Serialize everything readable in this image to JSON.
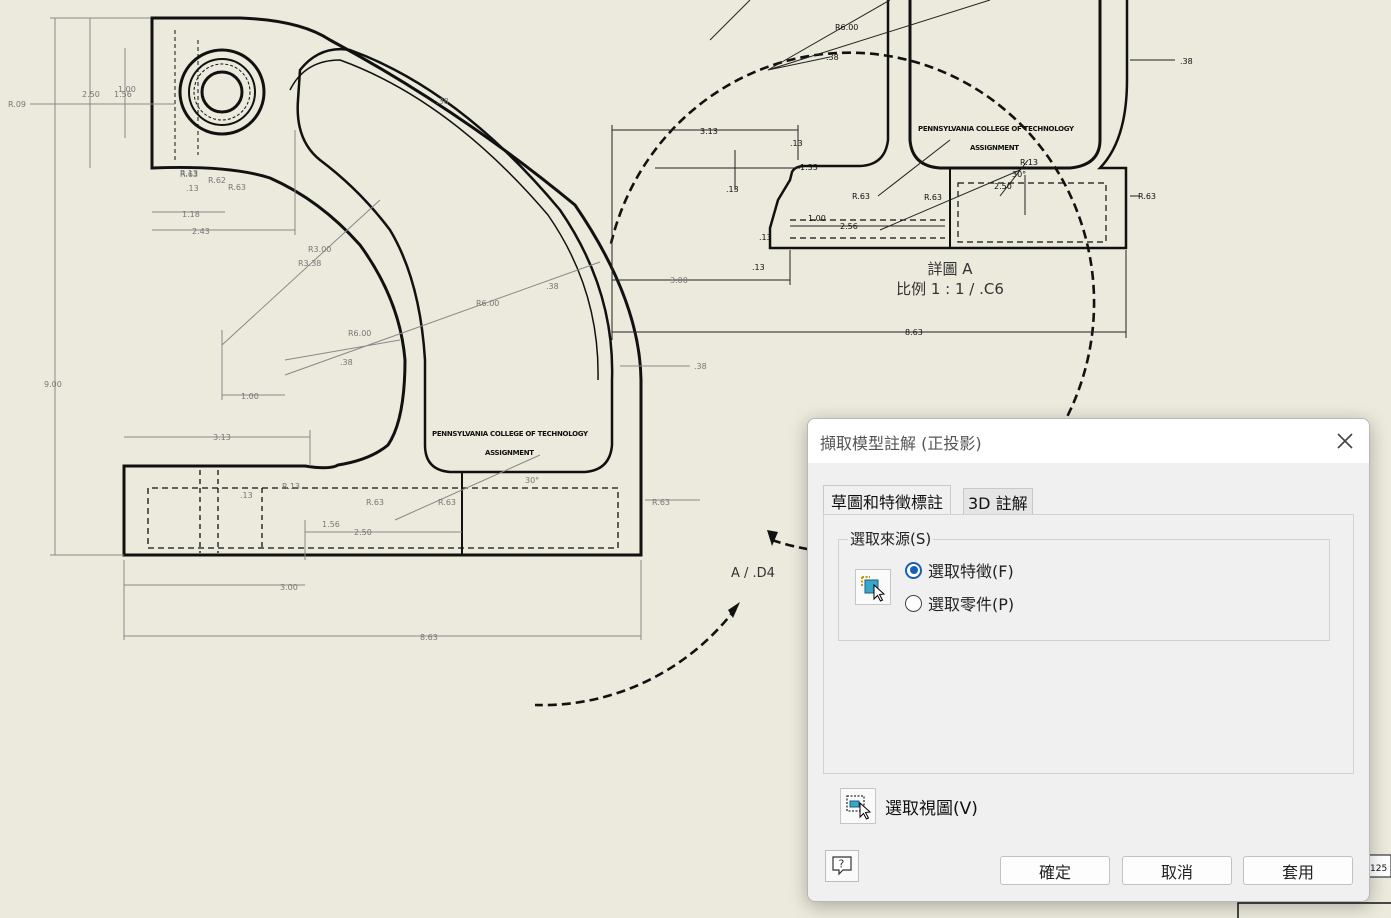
{
  "drawing": {
    "detail_view": {
      "title": "詳圖  A",
      "scale": "比例 1 : 1 / .C6"
    },
    "section_label": "A / .D4",
    "main_view_dims": [
      "R.09",
      "2.50",
      "1.00",
      "1.56",
      "R.63",
      "R.13",
      ".13",
      "R.62",
      "R.63",
      "1.18",
      "2.43",
      "R3.00",
      "R3.38",
      "R6.00",
      ".38",
      "1.00",
      "9.00",
      "3.13",
      ".13",
      "R.13",
      "2.50",
      "1.56",
      "R.63",
      "R.63",
      "R.63",
      "30°",
      "3.00",
      "8.63",
      "R6.00",
      ".38",
      ".38",
      "3.00",
      ".38"
    ],
    "detail_view_dims": [
      "R6.00",
      ".38",
      ".38",
      "3.13",
      ".13",
      ".13",
      "R.63",
      "R.63",
      "R.13",
      "30°",
      "2.50",
      "1.00",
      "2.56",
      ".13",
      "1.33",
      ".13",
      "R.63",
      "8.63"
    ],
    "engraving": {
      "line1": "PENNSYLVANIA COLLEGE OF TECHNOLOGY",
      "line2": "ASSIGNMENT"
    },
    "title_block_fragment": "125"
  },
  "dialog": {
    "title": "擷取模型註解 (正投影)",
    "icons": {
      "close": "close-icon",
      "select_feature": "select-feature-icon",
      "select_view": "select-view-icon",
      "help": "help-icon"
    },
    "tabs": [
      {
        "label": "草圖和特徵標註",
        "active": true
      },
      {
        "label": "3D 註解",
        "active": false
      }
    ],
    "source_group": {
      "legend": "選取來源(S)",
      "options": [
        {
          "label": "選取特徵(F)",
          "checked": true
        },
        {
          "label": "選取零件(P)",
          "checked": false
        }
      ]
    },
    "select_view_label": "選取視圖(V)",
    "buttons": {
      "ok": "確定",
      "cancel": "取消",
      "apply": "套用"
    },
    "accent_color": "#1a5fb4"
  }
}
